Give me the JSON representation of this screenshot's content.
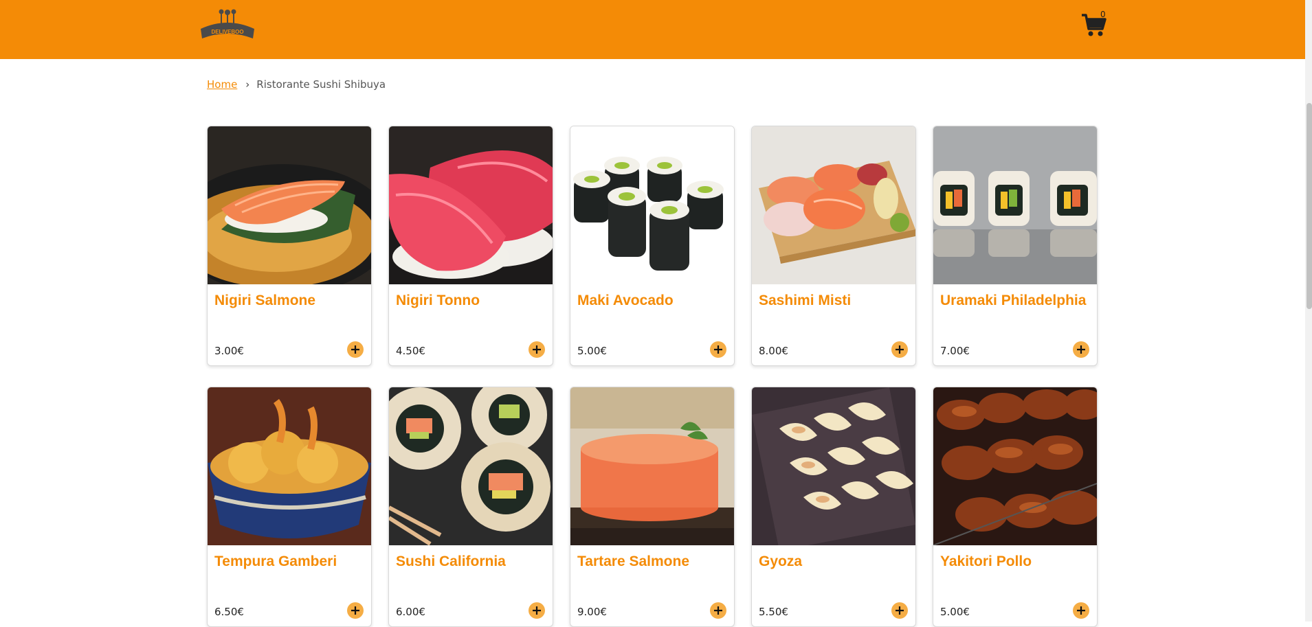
{
  "header": {
    "logo_text": "DELIVEBOO",
    "cart_count": "0",
    "accent_color": "#f48b06"
  },
  "breadcrumb": {
    "home": "Home",
    "separator": "›",
    "current": "Ristorante Sushi Shibuya"
  },
  "products": [
    {
      "name": "Nigiri Salmone",
      "price": "3.00€"
    },
    {
      "name": "Nigiri Tonno",
      "price": "4.50€"
    },
    {
      "name": "Maki Avocado",
      "price": "5.00€"
    },
    {
      "name": "Sashimi Misti",
      "price": "8.00€"
    },
    {
      "name": "Uramaki Philadelphia",
      "price": "7.00€"
    },
    {
      "name": "Tempura Gamberi",
      "price": "6.50€"
    },
    {
      "name": "Sushi California",
      "price": "6.00€"
    },
    {
      "name": "Tartare Salmone",
      "price": "9.00€"
    },
    {
      "name": "Gyoza",
      "price": "5.50€"
    },
    {
      "name": "Yakitori Pollo",
      "price": "5.00€"
    }
  ],
  "icons": {
    "cart": "shopping-cart-icon",
    "add": "plus-icon"
  }
}
